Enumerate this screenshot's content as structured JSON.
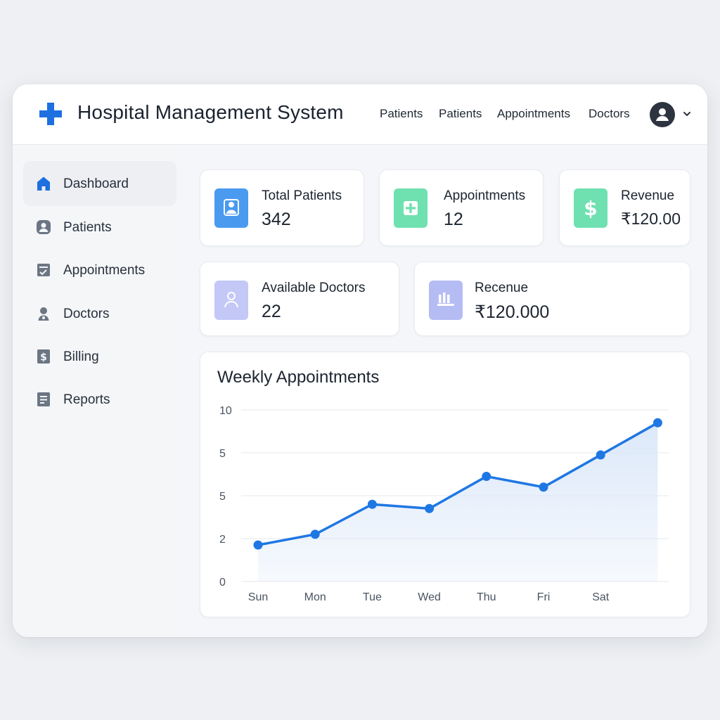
{
  "header": {
    "title": "Hospital Management System",
    "nav": [
      "Patients",
      "Patients",
      "Appointments",
      "Doctors"
    ]
  },
  "sidebar": {
    "items": [
      {
        "label": "Dashboard",
        "icon": "home-icon",
        "active": true
      },
      {
        "label": "Patients",
        "icon": "user-icon",
        "active": false
      },
      {
        "label": "Appointments",
        "icon": "calendar-icon",
        "active": false
      },
      {
        "label": "Doctors",
        "icon": "doctor-icon",
        "active": false
      },
      {
        "label": "Billing",
        "icon": "dollar-icon",
        "active": false
      },
      {
        "label": "Reports",
        "icon": "report-icon",
        "active": false
      }
    ]
  },
  "stats": [
    {
      "label": "Total Patients",
      "value": "342",
      "icon": "user-icon",
      "color": "#4a9af0"
    },
    {
      "label": "Appointments",
      "value": "12",
      "icon": "plus-icon",
      "color": "#6fe0b0"
    },
    {
      "label": "Revenue",
      "value": "₹120.00",
      "icon": "dollar-icon",
      "color": "#6fe0b0"
    },
    {
      "label": "Available Doctors",
      "value": "22",
      "icon": "doctor-icon",
      "color": "#c3c8f7"
    },
    {
      "label": "Recenue",
      "value": "₹120.000",
      "icon": "chart-bars-icon",
      "color": "#b5bcf4"
    }
  ],
  "colors": {
    "accent": "#1e6fe0",
    "line": "#1f77e3",
    "area": "#dce8f9"
  },
  "chart_data": {
    "type": "line",
    "title": "Weekly Appointments",
    "x": [
      "Sun",
      "Mon",
      "Tue",
      "Wed",
      "Thu",
      "Fri",
      "Sat"
    ],
    "y_tick_labels": [
      "0",
      "2",
      "5",
      "5",
      "10"
    ],
    "y_tick_values": [
      0,
      2,
      4,
      6,
      8
    ],
    "series": [
      {
        "values": [
          1.7,
          2.2,
          3.6,
          3.4,
          4.9,
          4.4,
          5.9,
          7.4
        ]
      }
    ],
    "ylim": [
      0,
      8
    ],
    "grid": true,
    "legend": "none"
  }
}
